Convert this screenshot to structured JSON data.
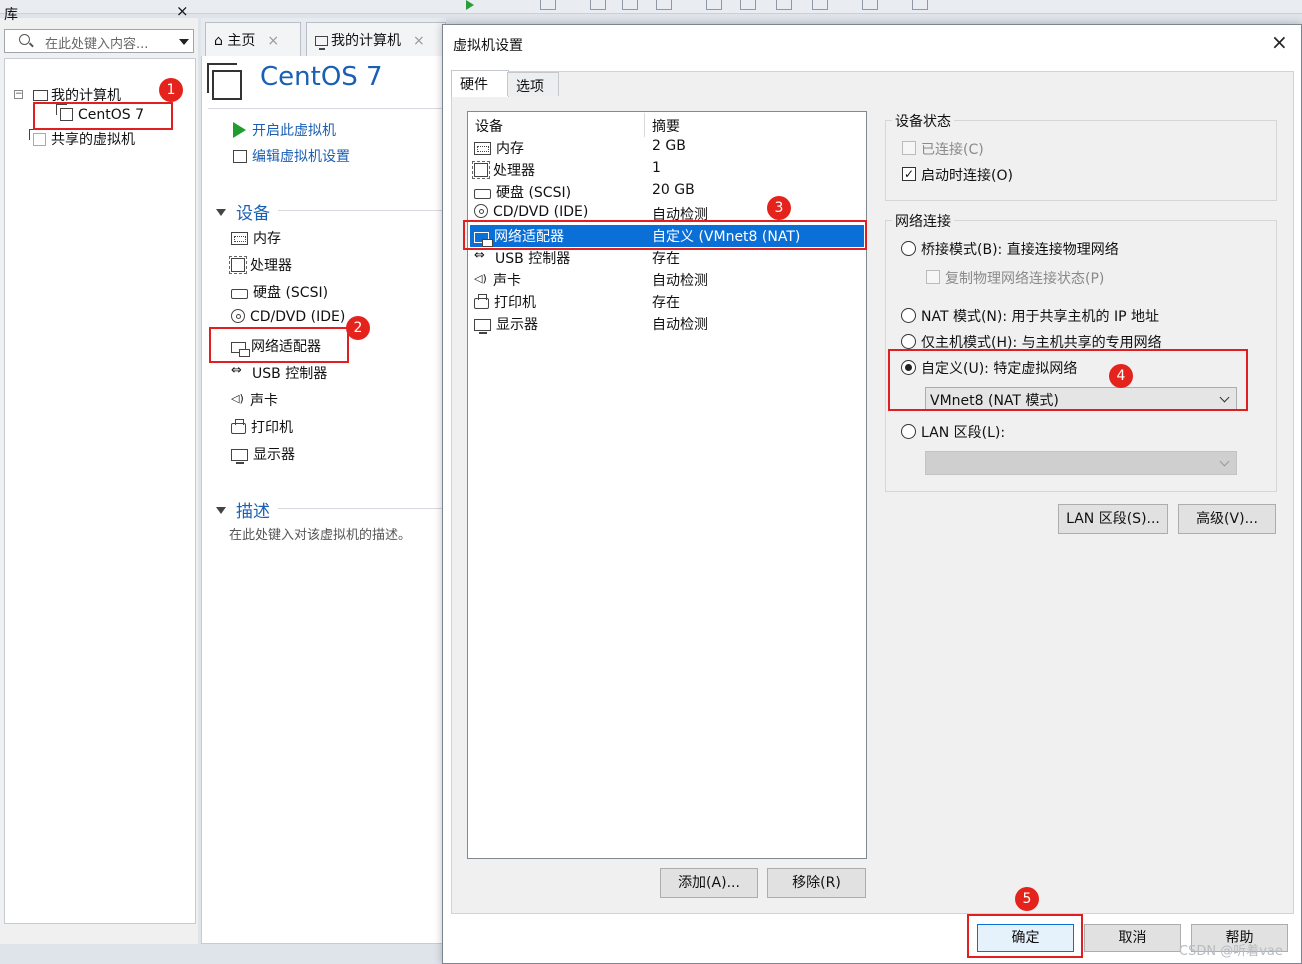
{
  "library": {
    "title": "库",
    "close": "×",
    "search_placeholder": "在此处键入内容...",
    "tree": [
      {
        "label": "我的计算机",
        "expander": "⊟"
      },
      {
        "label": "CentOS 7"
      },
      {
        "label": "共享的虚拟机"
      }
    ]
  },
  "tabs": [
    {
      "label": "主页",
      "close": "×"
    },
    {
      "label": "我的计算机",
      "close": "×"
    }
  ],
  "vm": {
    "name": "CentOS 7",
    "actions": {
      "start": "开启此虚拟机",
      "edit": "编辑虚拟机设置"
    },
    "devices_header": "设备",
    "devices": [
      "内存",
      "处理器",
      "硬盘 (SCSI)",
      "CD/DVD (IDE)",
      "网络适配器",
      "USB 控制器",
      "声卡",
      "打印机",
      "显示器"
    ],
    "description_header": "描述",
    "description_placeholder": "在此处键入对该虚拟机的描述。"
  },
  "dialog": {
    "title": "虚拟机设置",
    "close": "×",
    "tabs": [
      "硬件",
      "选项"
    ],
    "list_headers": {
      "device": "设备",
      "summary": "摘要"
    },
    "devices": [
      {
        "name": "内存",
        "summary": "2 GB",
        "icon": "memory-icon"
      },
      {
        "name": "处理器",
        "summary": "1",
        "icon": "cpu-icon"
      },
      {
        "name": "硬盘 (SCSI)",
        "summary": "20 GB",
        "icon": "hdd-icon"
      },
      {
        "name": "CD/DVD (IDE)",
        "summary": "自动检测",
        "icon": "cd-icon"
      },
      {
        "name": "网络适配器",
        "summary": "自定义 (VMnet8 (NAT)",
        "icon": "network-icon",
        "selected": true
      },
      {
        "name": "USB 控制器",
        "summary": "存在",
        "icon": "usb-icon"
      },
      {
        "name": "声卡",
        "summary": "自动检测",
        "icon": "sound-icon"
      },
      {
        "name": "打印机",
        "summary": "存在",
        "icon": "printer-icon"
      },
      {
        "name": "显示器",
        "summary": "自动检测",
        "icon": "display-icon"
      }
    ],
    "add_button": "添加(A)...",
    "remove_button": "移除(R)",
    "device_status": {
      "label": "设备状态",
      "connected": {
        "label": "已连接(C)",
        "checked": false,
        "disabled": true
      },
      "connect_on_start": {
        "label": "启动时连接(O)",
        "checked": true
      }
    },
    "network": {
      "label": "网络连接",
      "bridged": "桥接模式(B): 直接连接物理网络",
      "replicate": "复制物理网络连接状态(P)",
      "nat": "NAT 模式(N): 用于共享主机的 IP 地址",
      "host_only": "仅主机模式(H): 与主机共享的专用网络",
      "custom": "自定义(U): 特定虚拟网络",
      "custom_value": "VMnet8 (NAT 模式)",
      "lan": "LAN 区段(L):",
      "lan_value": "",
      "selected": "custom"
    },
    "lan_segments_button": "LAN 区段(S)...",
    "advanced_button": "高级(V)...",
    "ok_button": "确定",
    "cancel_button": "取消",
    "help_button": "帮助"
  },
  "annotations": [
    "1",
    "2",
    "3",
    "4",
    "5"
  ],
  "annotation_color": "#e4231d",
  "selection_color": "#0a6fd6",
  "watermark": "CSDN @听着vae"
}
